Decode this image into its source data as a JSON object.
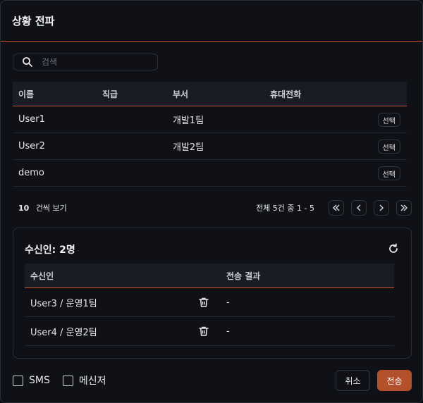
{
  "dialog": {
    "title": "상황 전파"
  },
  "search": {
    "placeholder": "검색",
    "value": "",
    "icon": "search-icon"
  },
  "users_table": {
    "headers": {
      "name": "이름",
      "rank": "직급",
      "dept": "부서",
      "phone": "휴대전화"
    },
    "rows": [
      {
        "name": "User1",
        "rank": "",
        "dept": "개발1팀",
        "phone": "",
        "action": "선택"
      },
      {
        "name": "User2",
        "rank": "",
        "dept": "개발2팀",
        "phone": "",
        "action": "선택"
      },
      {
        "name": "demo",
        "rank": "",
        "dept": "",
        "phone": "",
        "action": "선택"
      }
    ]
  },
  "pagination": {
    "per_page_value": "10",
    "per_page_label": "건씩 보기",
    "page_info": "전체 5건 중 1 - 5",
    "buttons": [
      "first-page",
      "prev-page",
      "next-page",
      "last-page"
    ]
  },
  "recipients": {
    "title": "수신인: 2명",
    "refresh_icon": "refresh-icon",
    "headers": {
      "recipient": "수신인",
      "result": "전송 결과"
    },
    "rows": [
      {
        "recipient": "User3 / 운영1팀",
        "result": "-"
      },
      {
        "recipient": "User4 / 운영2팀",
        "result": "-"
      }
    ]
  },
  "footer": {
    "options": [
      {
        "label": "SMS",
        "checked": false
      },
      {
        "label": "메신저",
        "checked": false
      }
    ],
    "cancel_label": "취소",
    "send_label": "전송"
  },
  "colors": {
    "accent": "#c2532a",
    "send_button": "#b3512d",
    "background": "#0f1117"
  }
}
